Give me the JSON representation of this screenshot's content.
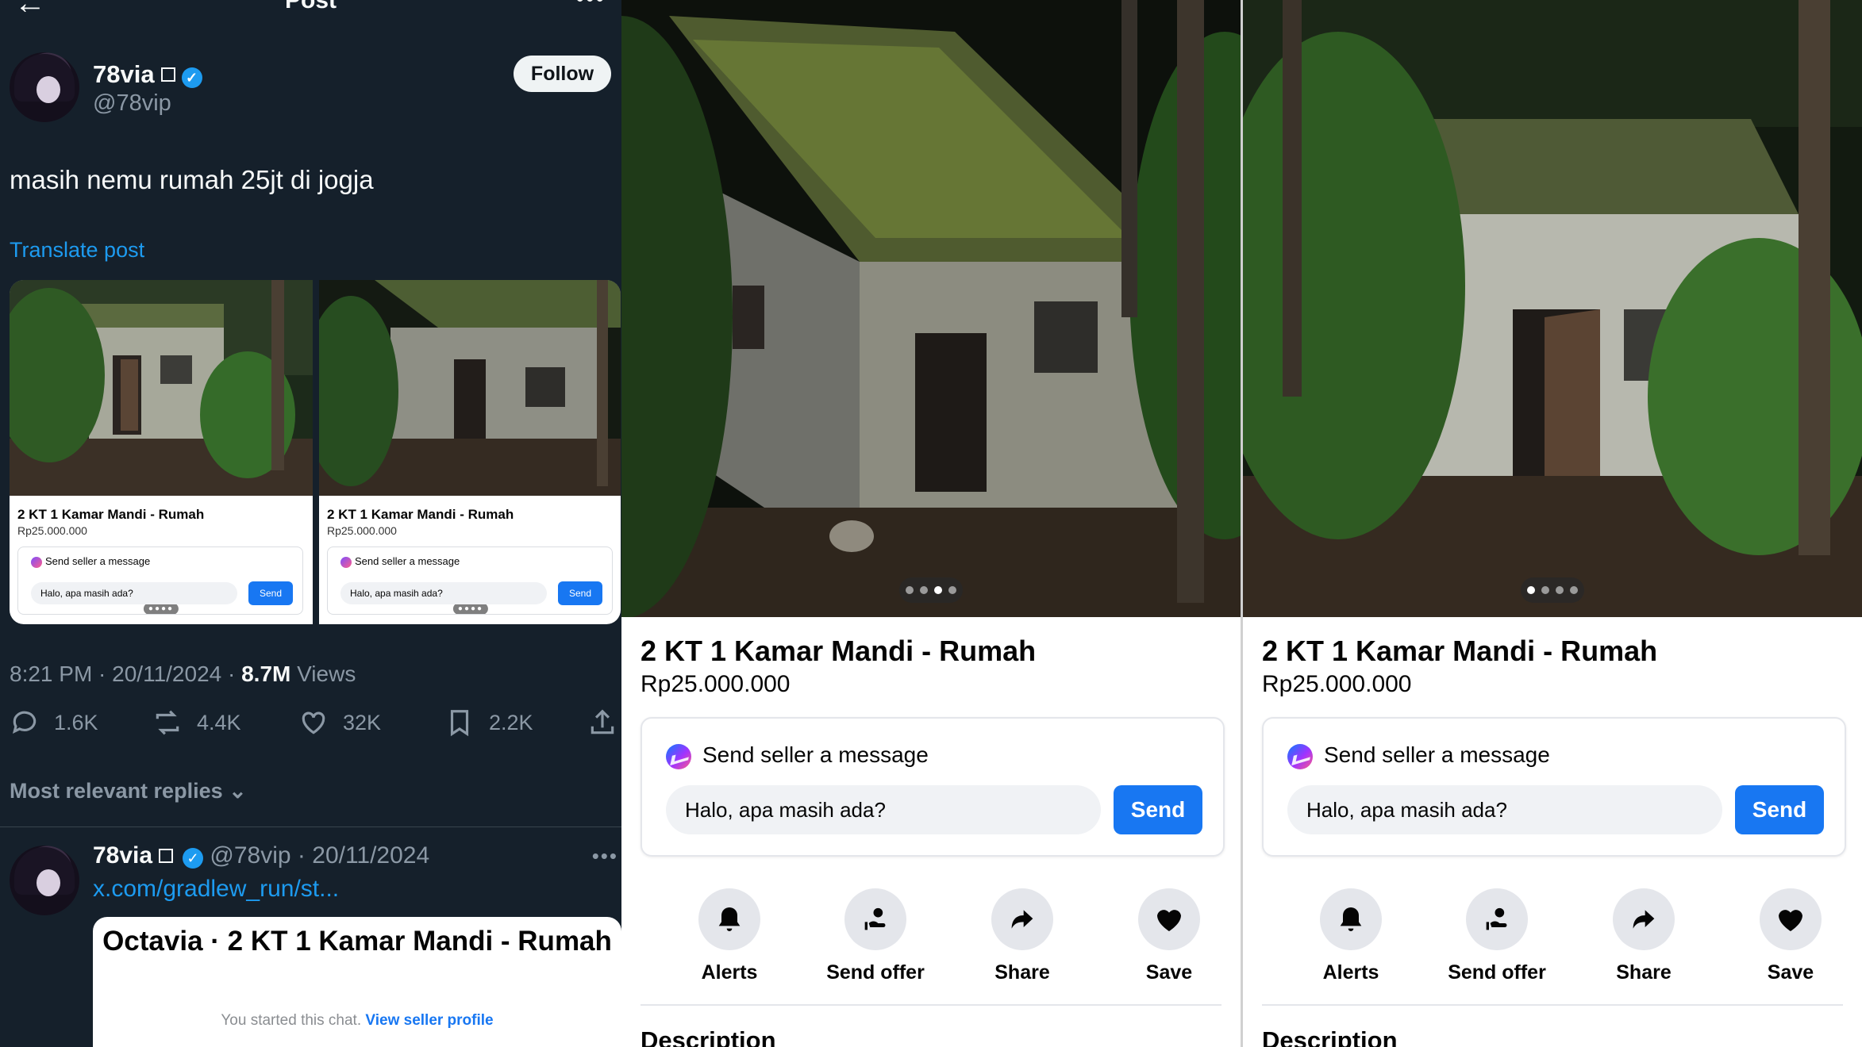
{
  "x_post": {
    "header_title": "Post",
    "author": {
      "name": "78via",
      "handle": "@78vip"
    },
    "follow_label": "Follow",
    "text": "masih nemu rumah 25jt di jogja",
    "translate_label": "Translate post",
    "thumbs": [
      {
        "title": "2 KT 1 Kamar Mandi - Rumah",
        "price": "Rp25.000.000",
        "msg_label": "Send seller a message",
        "input": "Halo, apa masih ada?",
        "send": "Send"
      },
      {
        "title": "2 KT 1 Kamar Mandi - Rumah",
        "price": "Rp25.000.000",
        "msg_label": "Send seller a message",
        "input": "Halo, apa masih ada?",
        "send": "Send"
      }
    ],
    "meta": {
      "time": "8:21 PM · 20/11/2024 · ",
      "views_count": "8.7M",
      "views_label": " Views"
    },
    "stats": {
      "replies": "1.6K",
      "reposts": "4.4K",
      "likes": "32K",
      "bookmarks": "2.2K"
    },
    "replies_sort": "Most relevant replies",
    "reply": {
      "name": "78via",
      "handle_date": "@78vip · 20/11/2024",
      "link": "x.com/gradlew_run/st...",
      "card_title": "Octavia · 2 KT 1 Kamar Mandi - Rumah",
      "card_sub": "You started this chat. ",
      "card_link": "View seller profile"
    }
  },
  "listings": [
    {
      "title": "2 KT 1 Kamar Mandi - Rumah",
      "price": "Rp25.000.000",
      "message_label": "Send seller a message",
      "message_value": "Halo, apa masih ada?",
      "send_label": "Send",
      "actions": [
        "Alerts",
        "Send offer",
        "Share",
        "Save"
      ],
      "description_heading": "Description",
      "pager_active": 3
    },
    {
      "title": "2 KT 1 Kamar Mandi - Rumah",
      "price": "Rp25.000.000",
      "message_label": "Send seller a message",
      "message_value": "Halo, apa masih ada?",
      "send_label": "Send",
      "actions": [
        "Alerts",
        "Send offer",
        "Share",
        "Save"
      ],
      "description_heading": "Description",
      "pager_active": 1
    }
  ],
  "colors": {
    "x_bg": "#15202b",
    "x_blue": "#1d9bf0",
    "fb_blue": "#1877f2",
    "muted": "#8b98a5"
  }
}
